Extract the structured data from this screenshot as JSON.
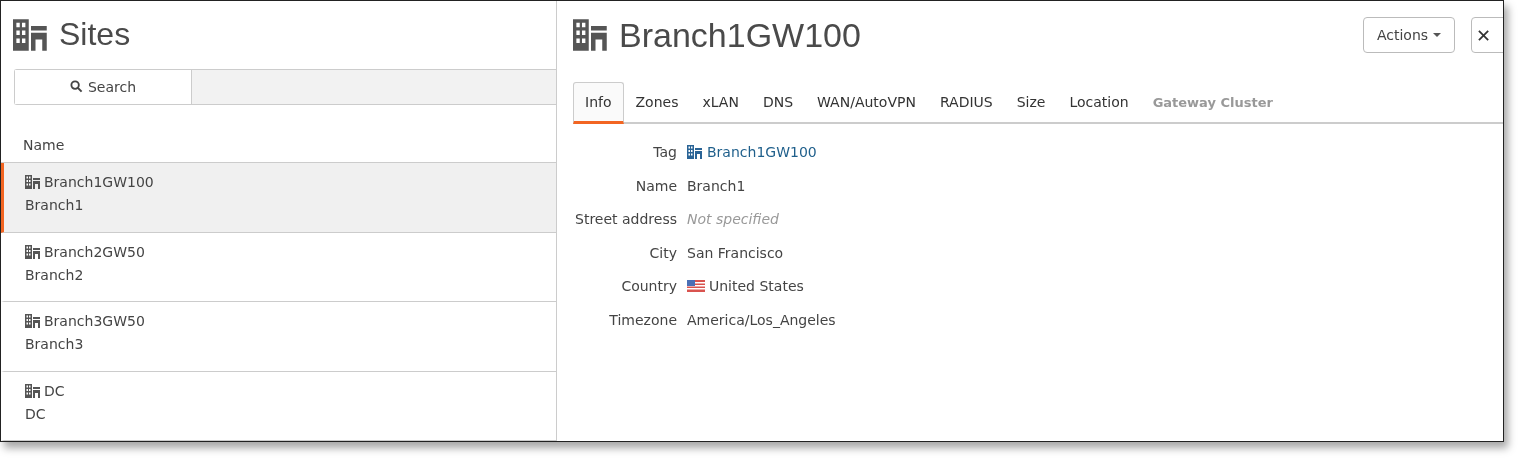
{
  "sites_panel": {
    "title": "Sites",
    "search_button": "Search",
    "column_header": "Name",
    "rows": [
      {
        "name": "Branch1GW100",
        "subtitle": "Branch1",
        "selected": true
      },
      {
        "name": "Branch2GW50",
        "subtitle": "Branch2",
        "selected": false
      },
      {
        "name": "Branch3GW50",
        "subtitle": "Branch3",
        "selected": false
      },
      {
        "name": "DC",
        "subtitle": "DC",
        "selected": false
      }
    ]
  },
  "detail_panel": {
    "title": "Branch1GW100",
    "actions_button": "Actions",
    "close_button": "✕",
    "tabs": [
      {
        "label": "Info",
        "selected": true,
        "disabled": false
      },
      {
        "label": "Zones",
        "selected": false,
        "disabled": false
      },
      {
        "label": "xLAN",
        "selected": false,
        "disabled": false
      },
      {
        "label": "DNS",
        "selected": false,
        "disabled": false
      },
      {
        "label": "WAN/AutoVPN",
        "selected": false,
        "disabled": false
      },
      {
        "label": "RADIUS",
        "selected": false,
        "disabled": false
      },
      {
        "label": "Size",
        "selected": false,
        "disabled": false
      },
      {
        "label": "Location",
        "selected": false,
        "disabled": false
      },
      {
        "label": "Gateway Cluster",
        "selected": false,
        "disabled": true
      }
    ],
    "fields": [
      {
        "label": "Tag",
        "value": "Branch1GW100",
        "kind": "link"
      },
      {
        "label": "Name",
        "value": "Branch1",
        "kind": "text"
      },
      {
        "label": "Street address",
        "value": "Not specified",
        "kind": "empty"
      },
      {
        "label": "City",
        "value": "San Francisco",
        "kind": "text"
      },
      {
        "label": "Country",
        "value": "United States",
        "kind": "flag"
      },
      {
        "label": "Timezone",
        "value": "America/Los_Angeles",
        "kind": "text"
      }
    ]
  }
}
